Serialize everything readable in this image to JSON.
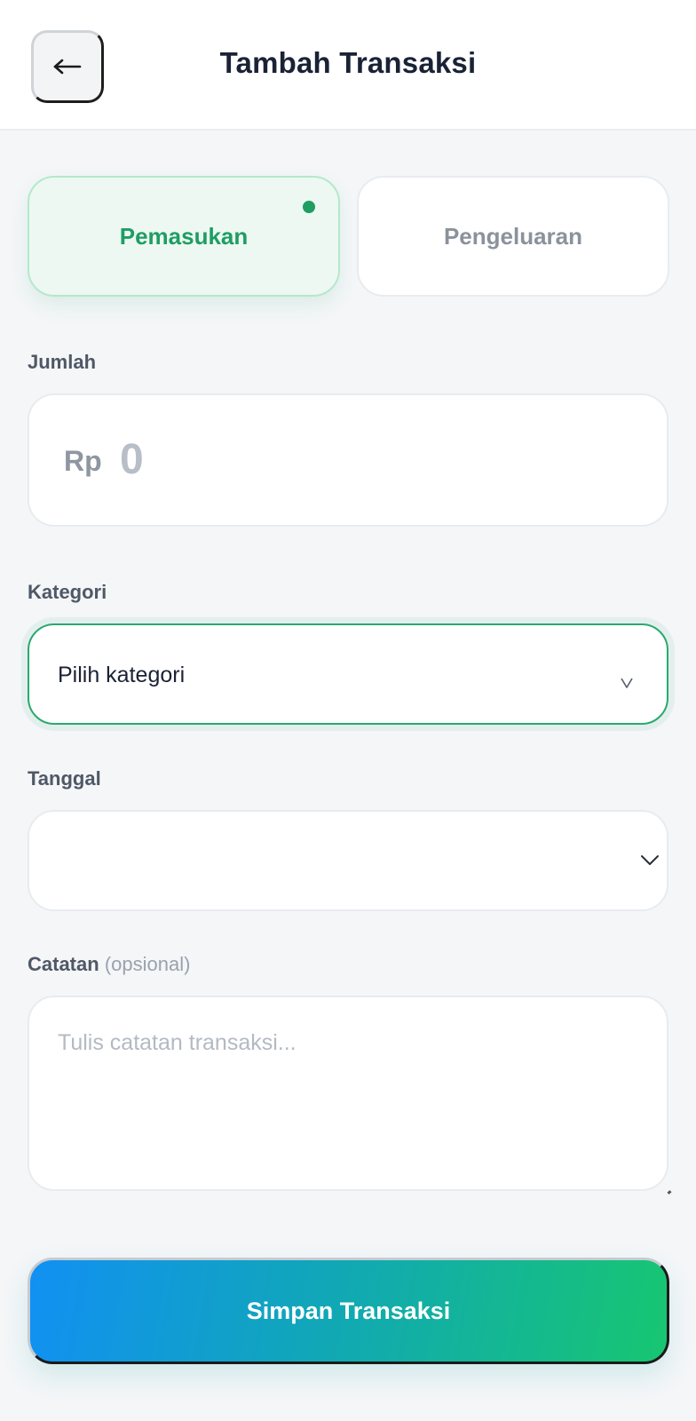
{
  "header": {
    "back_label": "←",
    "title": "Tambah Transaksi"
  },
  "type_toggle": {
    "income_label": "Pemasukan",
    "expense_label": "Pengeluaran",
    "selected": "Pemasukan"
  },
  "amount": {
    "label": "Jumlah",
    "currency": "Rp",
    "value": "0"
  },
  "category": {
    "label": "Kategori",
    "selected_value": "Pilih kategori",
    "chevron": "v"
  },
  "date": {
    "label": "Tanggal",
    "value": ""
  },
  "note": {
    "label": "Catatan",
    "optional_hint": "(opsional)",
    "placeholder": "Tulis catatan transaksi..."
  },
  "submit": {
    "label": "Simpan Transaksi"
  },
  "colors": {
    "accent_green": "#1f9d63",
    "gradient_start": "#1190f3",
    "gradient_end": "#17c671",
    "background": "#f4f6f8"
  },
  "icons": {
    "back": "arrow-left-icon",
    "category_dropdown": "chevron-down-icon",
    "date_dropdown": "chevron-down-icon",
    "active_indicator": "dot-icon"
  }
}
